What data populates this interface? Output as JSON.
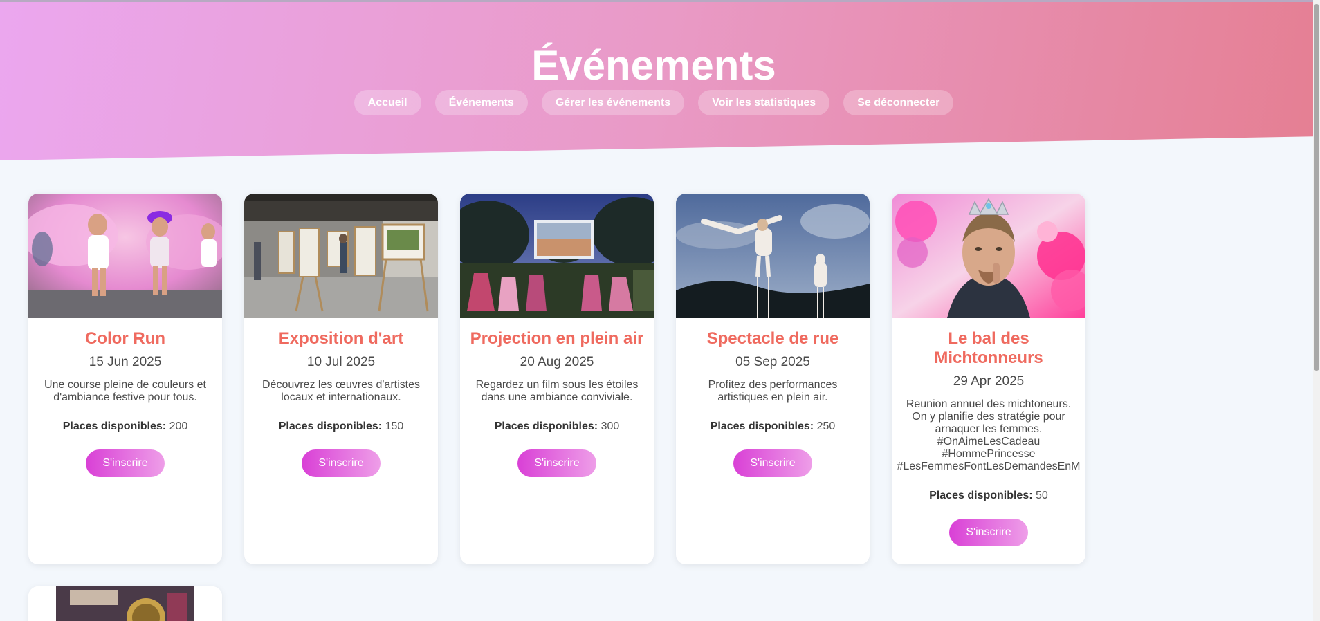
{
  "header": {
    "title": "Événements"
  },
  "nav": {
    "items": [
      {
        "label": "Accueil"
      },
      {
        "label": "Événements"
      },
      {
        "label": "Gérer les événements"
      },
      {
        "label": "Voir les statistiques"
      },
      {
        "label": "Se déconnecter"
      }
    ]
  },
  "events": [
    {
      "title": "Color Run",
      "date": "15 Jun 2025",
      "description": "Une course pleine de couleurs et\nd'ambiance festive pour tous.",
      "places_label": "Places disponibles:",
      "places": "200",
      "button": "S'inscrire",
      "image": "color-run-photo"
    },
    {
      "title": "Exposition d'art",
      "date": "10 Jul 2025",
      "description": "Découvrez les œuvres d'artistes\nlocaux et internationaux.",
      "places_label": "Places disponibles:",
      "places": "150",
      "button": "S'inscrire",
      "image": "art-exhibition-photo"
    },
    {
      "title": "Projection en plein air",
      "date": "20 Aug 2025",
      "description": "Regardez un film sous les étoiles\ndans une ambiance conviviale.",
      "places_label": "Places disponibles:",
      "places": "300",
      "button": "S'inscrire",
      "image": "outdoor-cinema-photo"
    },
    {
      "title": "Spectacle de rue",
      "date": "05 Sep 2025",
      "description": "Profitez des performances\nartistiques en plein air.",
      "places_label": "Places disponibles:",
      "places": "250",
      "button": "S'inscrire",
      "image": "street-show-photo"
    },
    {
      "title": "Le bal des\nMichtonneurs",
      "date": "29 Apr 2025",
      "description": "Reunion annuel des michtoneurs.\nOn y planifie des stratégie pour\narnaquer les femmes.\n#OnAimeLesCadeau\n#HommePrincesse\n#LesFemmesFontLesDemandesEnM",
      "places_label": "Places disponibles:",
      "places": "50",
      "button": "S'inscrire",
      "image": "bal-photo"
    }
  ],
  "partial_card": {
    "image": "bal-poster-photo"
  },
  "colors": {
    "title_accent": "#ef6a5f",
    "header_gradient_start": "#eba7ef",
    "header_gradient_end": "#e57f93",
    "button_gradient_start": "#d940d6",
    "button_gradient_end": "#ee9ee8"
  }
}
